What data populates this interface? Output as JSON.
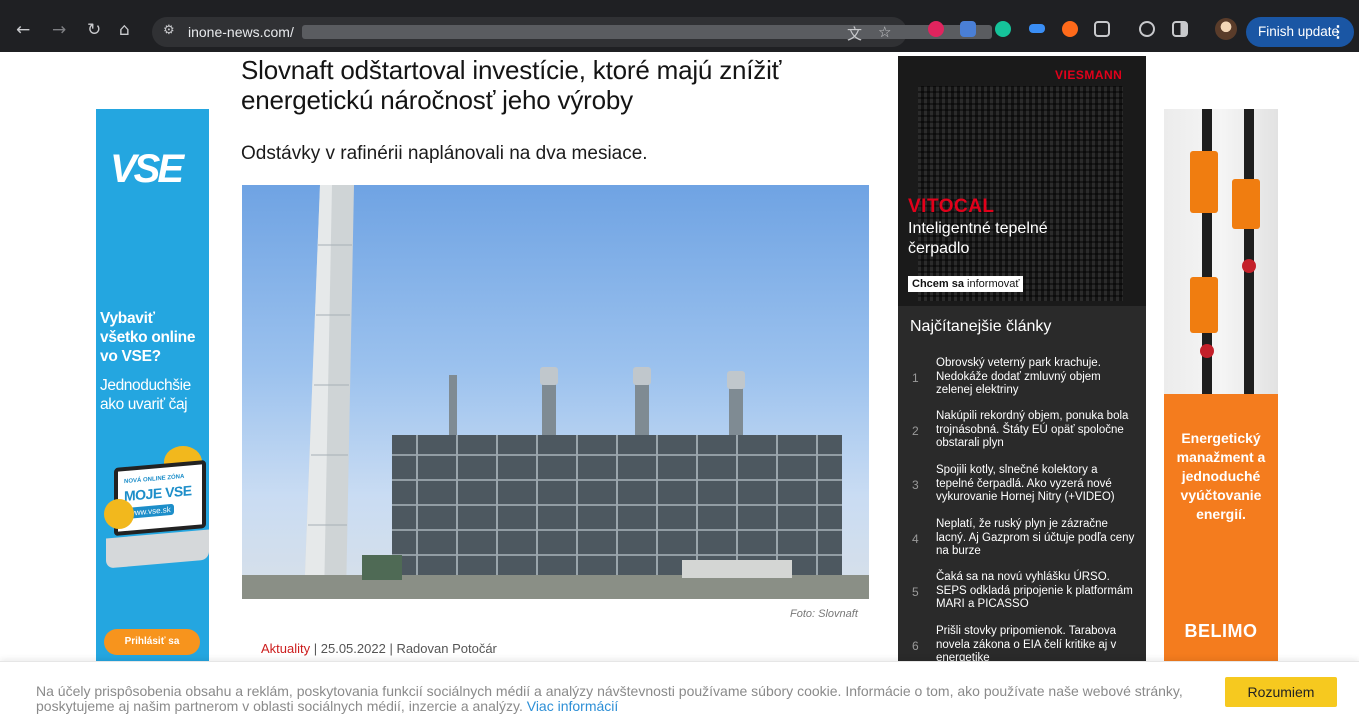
{
  "browser": {
    "url": "inone-news.com/",
    "finish_update": "Finish update",
    "menu_glyph": "⋮",
    "back_glyph": "←",
    "forward_glyph": "→",
    "reload_glyph": "↻",
    "home_glyph": "⌂",
    "site_info_glyph": "⚙",
    "translate_glyph": "文",
    "star_glyph": "☆",
    "extensions": [
      "opera-icon",
      "translate-ext-icon",
      "grammarly-icon",
      "screen-ext-icon",
      "firefox-ext-icon",
      "puzzle-icon",
      "sync-icon",
      "sidepanel-icon",
      "profile-avatar"
    ]
  },
  "left_ad": {
    "logo": "VSE",
    "line1": "Vybaviť všetko online vo VSE?",
    "line2": "Jednoduchšie ako uvariť čaj",
    "zone_small": "NOVÁ ONLINE ZÓNA",
    "zone_name": "MOJE VSE",
    "zone_url": "www.vse.sk",
    "login": "Prihlásiť sa"
  },
  "article": {
    "headline": "Slovnaft odštartoval investície, ktoré majú znížiť energetickú náročnosť jeho výroby",
    "subhead": "Odstávky v rafinérii naplánovali na dva mesiace.",
    "photo_caption": "Foto: Slovnaft",
    "category": "Aktuality",
    "sep1": " | ",
    "date": "25.05.2022",
    "sep2": " |  ",
    "author": "Radovan Potočár"
  },
  "mid_ad": {
    "brand": "VIESMANN",
    "product": "VITOCAL",
    "tagline": "Inteligentné tepelné čerpadlo",
    "cta_bold": "Chcem sa",
    "cta_rest": " informovať"
  },
  "most_read": {
    "title": "Najčítanejšie články",
    "items": [
      {
        "num": "1",
        "text": "Obrovský veterný park krachuje. Nedokáže dodať zmluvný objem zelenej elektriny"
      },
      {
        "num": "2",
        "text": "Nakúpili rekordný objem, ponuka bola trojnásobná. Štáty EÚ opäť spoločne obstarali plyn"
      },
      {
        "num": "3",
        "text": "Spojili kotly, slnečné kolektory a tepelné čerpadlá. Ako vyzerá nové vykurovanie Hornej Nitry (+VIDEO)"
      },
      {
        "num": "4",
        "text": "Neplatí, že ruský plyn je zázračne lacný. Aj Gazprom si účtuje podľa ceny na burze"
      },
      {
        "num": "5",
        "text": "Čaká sa na novú vyhlášku ÚRSO. SEPS odkladá pripojenie k platformám MARI a PICASSO"
      },
      {
        "num": "6",
        "text": "Prišli stovky pripomienok. Tarabova novela zákona o EIA čelí kritike aj v energetike"
      }
    ]
  },
  "right_ad": {
    "text": "Energetický manažment a jednoduché vyúčtovanie energií.",
    "brand": "BELIMO"
  },
  "cookie": {
    "message": "Na účely prispôsobenia obsahu a reklám, poskytovania funkcií sociálnych médií a analýzy návštevnosti používame súbory cookie. Informácie o tom, ako používate naše webové stránky, poskytujeme aj našim partnerom v oblasti sociálnych médií, inzercie a analýzy. ",
    "more": "Viac informácií",
    "accept": "Rozumiem"
  }
}
